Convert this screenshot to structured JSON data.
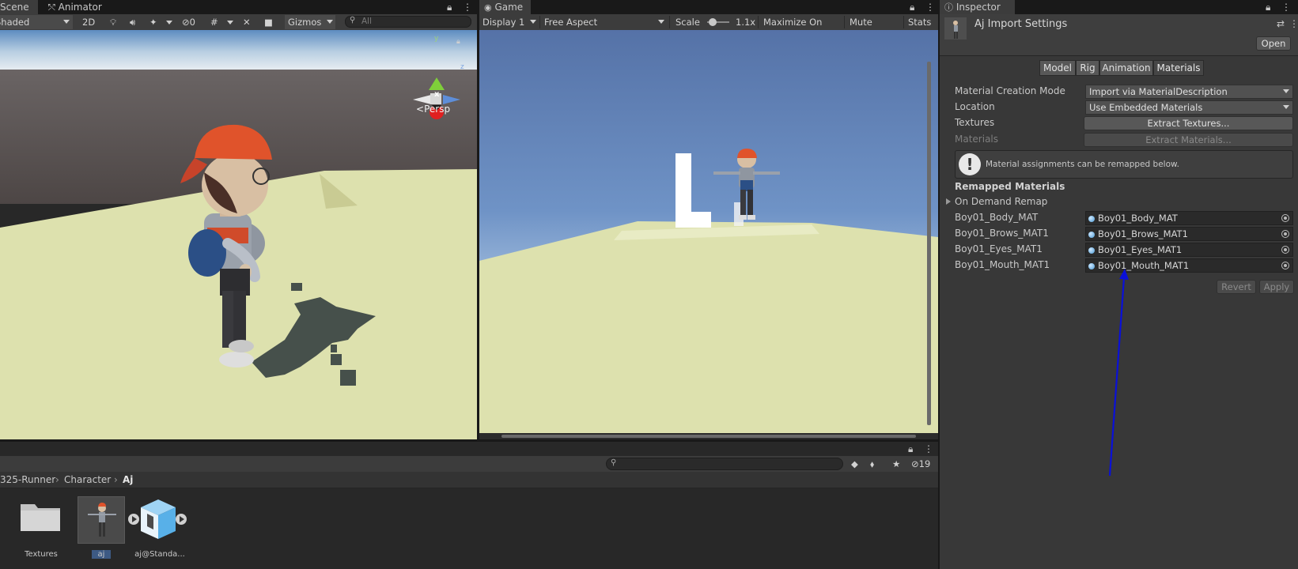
{
  "scene_panel": {
    "tabs": [
      "Scene",
      "Animator"
    ],
    "shading_mode": "Shaded",
    "toggle_2d": "2D",
    "hidden_count": "0",
    "gizmos_label": "Gizmos",
    "search_placeholder": "All",
    "gizmo_axes": {
      "y": "y",
      "z": "z",
      "x": "x"
    },
    "persp_label": "Persp"
  },
  "game_panel": {
    "tab": "Game",
    "display": "Display 1",
    "aspect": "Free Aspect",
    "scale_label": "Scale",
    "scale_value": "1.1x",
    "maximize": "Maximize On Play",
    "mute": "Mute Audio",
    "stats": "Stats"
  },
  "project_panel": {
    "breadcrumb": [
      "325-Runner",
      "Character",
      "Aj"
    ],
    "visible_count": "19",
    "items": [
      {
        "label": "Textures",
        "icon": "folder-icon"
      },
      {
        "label": "aj",
        "icon": "model-thumbnail"
      },
      {
        "label": "aj@Standa...",
        "icon": "prefab-icon"
      }
    ]
  },
  "inspector": {
    "tab": "Inspector",
    "title": "Aj Import Settings",
    "open_button": "Open",
    "subtabs": [
      "Model",
      "Rig",
      "Animation",
      "Materials"
    ],
    "active_subtab": "Materials",
    "creation_mode_label": "Material Creation Mode",
    "creation_mode_value": "Import via MaterialDescription",
    "location_label": "Location",
    "location_value": "Use Embedded Materials",
    "textures_label": "Textures",
    "extract_textures": "Extract Textures...",
    "materials_label": "Materials",
    "extract_materials": "Extract Materials...",
    "info_text": "Material assignments can be remapped below.",
    "remapped_header": "Remapped Materials",
    "on_demand": "On Demand Remap",
    "remaps": [
      {
        "name": "Boy01_Body_MAT",
        "value": "Boy01_Body_MAT"
      },
      {
        "name": "Boy01_Brows_MAT1",
        "value": "Boy01_Brows_MAT1"
      },
      {
        "name": "Boy01_Eyes_MAT1",
        "value": "Boy01_Eyes_MAT1"
      },
      {
        "name": "Boy01_Mouth_MAT1",
        "value": "Boy01_Mouth_MAT1"
      }
    ],
    "revert": "Revert",
    "apply": "Apply"
  },
  "colors": {
    "annotation_arrow": "#0a10d8",
    "editor_dark": "#282828",
    "toolbar": "#3c3c3c",
    "ground": "#dde1ae",
    "sky_top": "#5a77a8",
    "cap_orange": "#e0532b"
  }
}
